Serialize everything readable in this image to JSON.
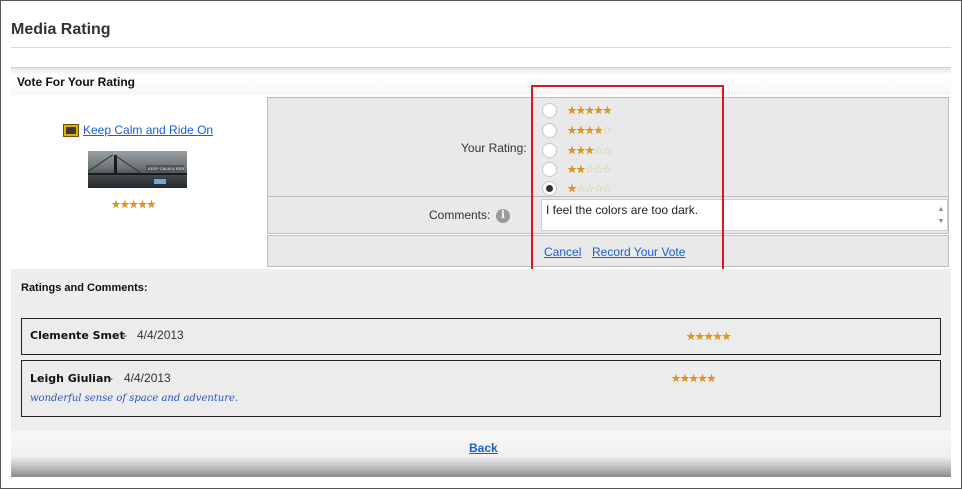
{
  "page": {
    "title": "Media Rating"
  },
  "vote_section": {
    "heading": "Vote For Your Rating"
  },
  "media": {
    "link_text": "Keep Calm and Ride On",
    "thumbnail_caption": "KEEP CALM & RIDE ON",
    "average_rating": 5,
    "max_rating": 5
  },
  "form": {
    "rating_label": "Your Rating:",
    "comments_label": "Comments:",
    "info_glyph": "i",
    "rating_options": [
      {
        "stars": 5,
        "selected": false
      },
      {
        "stars": 4,
        "selected": false
      },
      {
        "stars": 3,
        "selected": false
      },
      {
        "stars": 2,
        "selected": false
      },
      {
        "stars": 1,
        "selected": true
      }
    ],
    "comment_value": "I feel the colors are too dark.",
    "cancel_label": "Cancel",
    "record_vote_label": "Record Your Vote"
  },
  "ratings": {
    "heading": "Ratings and Comments:",
    "separator": "-",
    "items": [
      {
        "author": "Clemente Smet",
        "date": "4/4/2013",
        "stars": 5,
        "comment": ""
      },
      {
        "author": "Leigh Giulian",
        "date": "4/4/2013",
        "stars": 5,
        "comment": "wonderful sense of space and adventure."
      }
    ]
  },
  "footer": {
    "back_label": "Back"
  },
  "colors": {
    "link": "#1a5fd0",
    "highlight": "#d71920",
    "star": "#e0961e"
  },
  "icons": {
    "media": "media-file-icon",
    "info": "info-icon",
    "radio": "radio-button"
  }
}
